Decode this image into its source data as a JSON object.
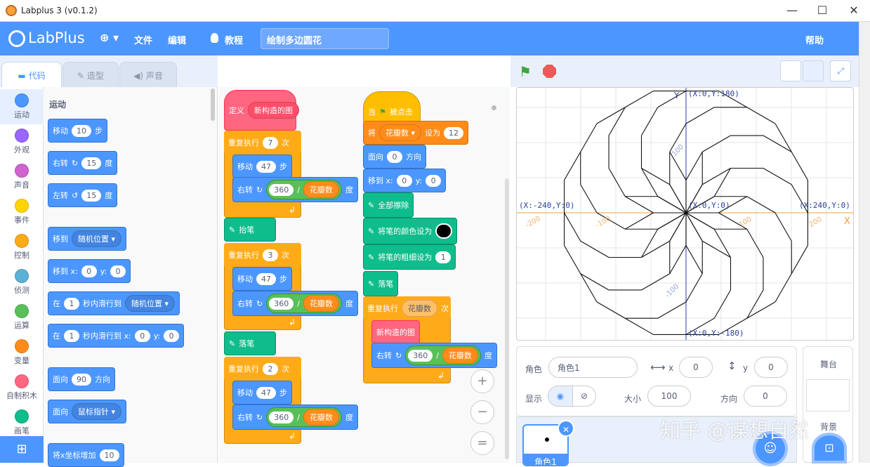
{
  "window": {
    "title": "Labplus 3 (v0.1.2)",
    "minimize": "—",
    "maximize": "☐",
    "close": "✕"
  },
  "menu": {
    "logo": "LabPlus",
    "globe": "⊕ ▾",
    "file": "文件",
    "edit": "编辑",
    "tutorial": "教程",
    "project_title": "绘制多边圆花",
    "help": "帮助"
  },
  "tabs": {
    "code": "代码",
    "costume": "造型",
    "sound": "声音"
  },
  "categories": [
    {
      "label": "运动",
      "color": "#4c97ff"
    },
    {
      "label": "外观",
      "color": "#9966ff"
    },
    {
      "label": "声音",
      "color": "#cf63cf"
    },
    {
      "label": "事件",
      "color": "#ffd500"
    },
    {
      "label": "控制",
      "color": "#ffab19"
    },
    {
      "label": "侦测",
      "color": "#5cb1d6"
    },
    {
      "label": "运算",
      "color": "#59c059"
    },
    {
      "label": "变量",
      "color": "#ff8c1a"
    },
    {
      "label": "自制积木",
      "color": "#ff6680"
    },
    {
      "label": "画笔",
      "color": "#0fbd8c"
    }
  ],
  "palette": {
    "heading": "运动",
    "move": {
      "a": "移动",
      "v": "10",
      "b": "步"
    },
    "turn_right": {
      "a": "右转",
      "v": "15",
      "b": "度"
    },
    "turn_left": {
      "a": "左转",
      "v": "15",
      "b": "度"
    },
    "goto": {
      "a": "移到",
      "d": "随机位置 ▾"
    },
    "goto_xy": {
      "a": "移到 x:",
      "x": "0",
      "y_lbl": "y:",
      "y": "0"
    },
    "glide": {
      "a": "在",
      "v": "1",
      "b": "秒内滑行到",
      "d": "随机位置 ▾"
    },
    "glide_xy": {
      "a": "在",
      "v": "1",
      "b": "秒内滑行到 x:",
      "x": "0",
      "y_lbl": "y:",
      "y": "0"
    },
    "point_dir": {
      "a": "面向",
      "v": "90",
      "b": "方向"
    },
    "point_toward": {
      "a": "面向",
      "d": "鼠标指针 ▾"
    },
    "change_x": {
      "a": "将x坐标增加",
      "v": "10"
    }
  },
  "script1": {
    "define": "定义",
    "define_name": "新构造的图",
    "repeat": "重复执行",
    "times": "次",
    "r1": "7",
    "r2": "3",
    "r3": "2",
    "move": "移动",
    "steps": "步",
    "move_v": "47",
    "turn": "右转",
    "deg": "度",
    "v360": "360",
    "div": "/",
    "var": "花瓣数",
    "pen_up": "抬笔",
    "pen_down": "落笔"
  },
  "script2": {
    "hat": "当",
    "hat2": "被点击",
    "set": "将",
    "set_var": "花瓣数 ▾",
    "set_to": "设为",
    "set_v": "12",
    "face": "面向",
    "face_v": "0",
    "face_b": "方向",
    "goto": "移到 x:",
    "gx": "0",
    "gy_lbl": "y:",
    "gy": "0",
    "clear": "全部擦除",
    "pen_color": "将笔的颜色设为",
    "pen_size": "将笔的粗细设为",
    "pen_size_v": "1",
    "pen_down": "落笔",
    "repeat": "重复执行",
    "repeat_var": "花瓣数",
    "times": "次",
    "call": "新构造的图",
    "turn": "右转",
    "v360": "360",
    "div": "/",
    "var": "花瓣数",
    "deg": "度"
  },
  "zoom": {
    "in": "+",
    "out": "−",
    "reset": "="
  },
  "stage": {
    "y_axis": "Y",
    "x_axis": "X",
    "top": "(X:0,Y:180)",
    "bottom": "(X:0,Y:-180)",
    "left": "(X:-240,Y:0)",
    "right": "(X:240,Y:0)",
    "center": "(X:0,Y:0)",
    "ticks": [
      "-200",
      "-100",
      "100",
      "200"
    ],
    "yticks": [
      "100",
      "-100"
    ]
  },
  "sprite": {
    "label": "角色",
    "name": "角色1",
    "x_lbl": "x",
    "x": "0",
    "y_lbl": "y",
    "y": "0",
    "show": "显示",
    "size_lbl": "大小",
    "size": "100",
    "dir_lbl": "方向",
    "dir": "0",
    "thumb_name": "角色1"
  },
  "stage_panel": {
    "label": "舞台",
    "backdrop": "背景"
  },
  "watermark": "知乎 @谋想自然"
}
